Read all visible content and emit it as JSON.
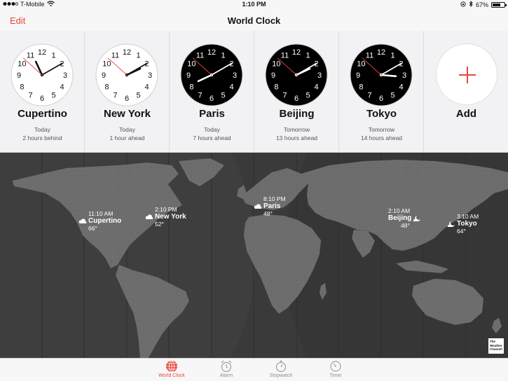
{
  "status_bar": {
    "carrier": "T-Mobile",
    "time": "1:10 PM",
    "battery": "67%",
    "battery_level": 0.67
  },
  "nav": {
    "edit_label": "Edit",
    "title": "World Clock"
  },
  "clocks": [
    {
      "city": "Cupertino",
      "day": "Today",
      "offset": "2 hours behind",
      "hour": 11,
      "minute": 10,
      "second": 52,
      "face": "light"
    },
    {
      "city": "New York",
      "day": "Today",
      "offset": "1 hour ahead",
      "hour": 2,
      "minute": 10,
      "second": 52,
      "face": "light"
    },
    {
      "city": "Paris",
      "day": "Today",
      "offset": "7 hours ahead",
      "hour": 8,
      "minute": 10,
      "second": 52,
      "face": "dark"
    },
    {
      "city": "Beijing",
      "day": "Tomorrow",
      "offset": "13 hours ahead",
      "hour": 2,
      "minute": 10,
      "second": 52,
      "face": "dark"
    },
    {
      "city": "Tokyo",
      "day": "Tomorrow",
      "offset": "14 hours ahead",
      "hour": 3,
      "minute": 10,
      "second": 52,
      "face": "dark"
    }
  ],
  "add": {
    "label": "Add"
  },
  "map_locations": [
    {
      "time": "11:10 AM",
      "city": "Cupertino",
      "temp": "66°",
      "icon": "cloud-icon"
    },
    {
      "time": "2:10 PM",
      "city": "New York",
      "temp": "52°",
      "icon": "cloud-icon"
    },
    {
      "time": "8:10 PM",
      "city": "Paris",
      "temp": "48°",
      "icon": "cloud-icon"
    },
    {
      "time": "2:10 AM",
      "city": "Beijing",
      "temp": "48°",
      "icon": "moon-cloud-icon"
    },
    {
      "time": "3:10 AM",
      "city": "Tokyo",
      "temp": "64°",
      "icon": "moon-cloud-icon"
    }
  ],
  "weather_logo": {
    "line1": "The",
    "line2": "Weather",
    "line3": "Channel"
  },
  "tabs": [
    {
      "label": "World Clock",
      "icon": "globe-icon",
      "active": true
    },
    {
      "label": "Alarm",
      "icon": "alarm-clock-icon",
      "active": false
    },
    {
      "label": "Stopwatch",
      "icon": "stopwatch-icon",
      "active": false
    },
    {
      "label": "Timer",
      "icon": "timer-icon",
      "active": false
    }
  ],
  "colors": {
    "accent": "#e7473a",
    "map_land": "#6e6e6e",
    "map_water": "#3a3a3a"
  }
}
